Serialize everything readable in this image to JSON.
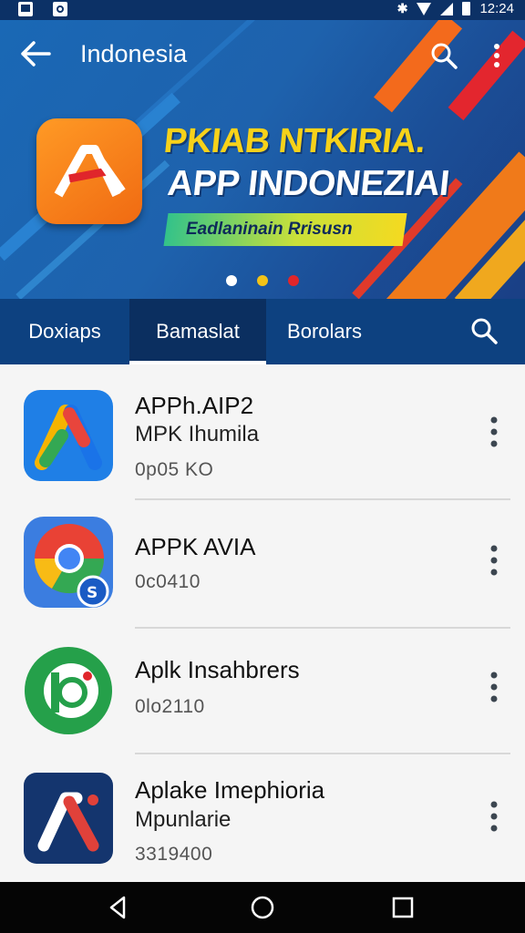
{
  "status_bar": {
    "time": "12:24",
    "bluetooth": "✱"
  },
  "header": {
    "title": "Indonesia",
    "banner": {
      "headline_line1": "PKIAB NTKIRIA.",
      "headline_line2": "APP INDONEZIAI",
      "tagline": "Eadlaninain Rrisusn",
      "logo_text": "AI",
      "carousel_dots": [
        {
          "color": "#ffffff",
          "active": true
        },
        {
          "color": "#f2c318",
          "active": false
        },
        {
          "color": "#e0262b",
          "active": false
        }
      ]
    }
  },
  "tabs": [
    {
      "label": "Doxiaps",
      "active": false
    },
    {
      "label": "Bamaslat",
      "active": true
    },
    {
      "label": "Borolars",
      "active": false
    }
  ],
  "apps": [
    {
      "name": "APPh.AIP2",
      "subtitle": "MPK Ihumila",
      "meta": "0p05 KO",
      "icon": "google-ads-style-icon"
    },
    {
      "name": "APPK AVIA",
      "subtitle": "",
      "meta": "0c0410",
      "icon": "chrome-style-icon"
    },
    {
      "name": "Aplk Insahbrers",
      "subtitle": "",
      "meta": "0lo2110",
      "icon": "green-circle-app-icon"
    },
    {
      "name": "Aplake Imephioria",
      "subtitle": "Mpunlarie",
      "meta": "3319400",
      "icon": "navy-a-app-icon"
    }
  ],
  "colors": {
    "primary": "#0d4180",
    "primary_dark": "#0b2f60",
    "accent_orange": "#ff6a1a",
    "accent_yellow": "#f7d21a"
  }
}
